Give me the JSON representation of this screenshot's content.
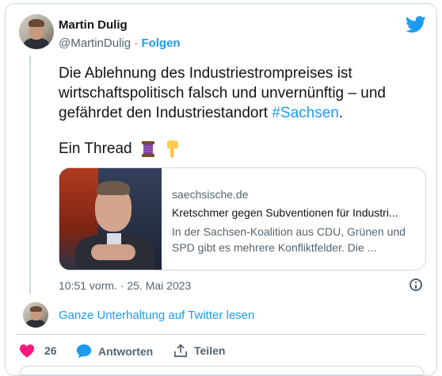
{
  "author": {
    "name": "Martin Dulig",
    "handle": "@MartinDulig",
    "separator": " · ",
    "follow_label": "Folgen"
  },
  "tweet": {
    "text_before_hashtag": "Die Ablehnung des Industriestrompreises ist wirtschaftspolitisch falsch und unvernünftig – und gefährdet den Industriestandort ",
    "hashtag": "#Sachsen",
    "text_after_hashtag": ".",
    "thread_line": "Ein Thread",
    "emoji_1": "🧵",
    "emoji_2": "👇"
  },
  "link_card": {
    "domain": "saechsische.de",
    "title": "Kretschmer gegen Subventionen für Industri...",
    "description": "In der Sachsen-Koalition aus CDU, Grünen und SPD gibt es mehrere Konfliktfelder. Die ..."
  },
  "timestamp": "10:51 vorm. · 25. Mai 2023",
  "conversation_link": "Ganze Unterhaltung auf Twitter lesen",
  "actions": {
    "like_count": "26",
    "reply_label": "Antworten",
    "share_label": "Teilen"
  },
  "colors": {
    "accent": "#1d9bf0",
    "like": "#f91880",
    "text_primary": "#0f1419",
    "text_secondary": "#536471",
    "border": "#cfd9de"
  },
  "icons": [
    "twitter-bird-icon",
    "info-icon",
    "heart-icon",
    "reply-icon",
    "share-icon"
  ]
}
